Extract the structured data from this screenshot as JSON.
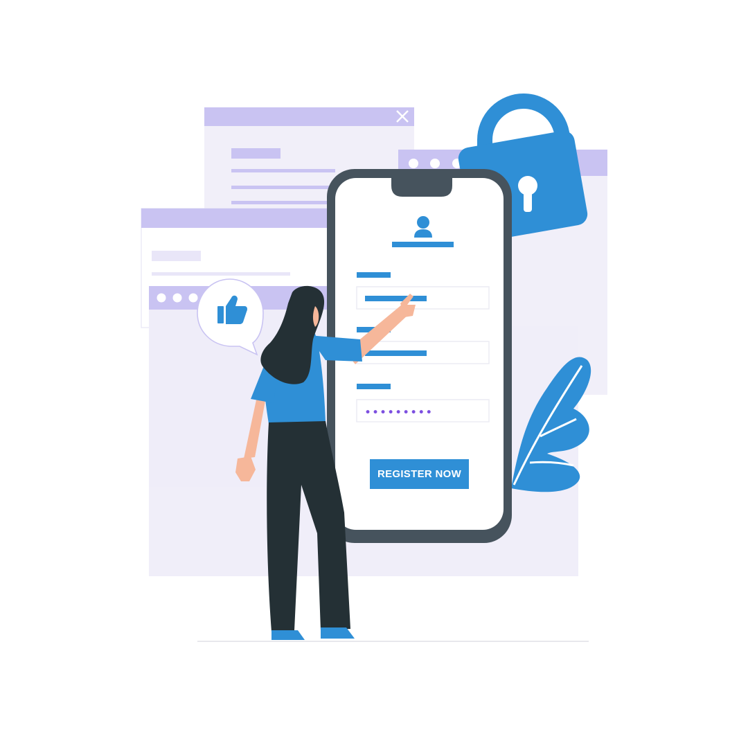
{
  "colors": {
    "window_header": "#c9c3f2",
    "window_body": "#eeecf8",
    "accent_blue": "#2f8fd6",
    "phone_frame": "#46535d",
    "password_dots": "#7c4fe0",
    "pants": "#243035",
    "skin": "#f6b79a"
  },
  "icons": [
    "close-icon",
    "lock-icon",
    "thumbs-up-icon",
    "user-icon",
    "leaf-icon"
  ],
  "form": {
    "password_mask": "•••••••••",
    "register_label": "REGISTER NOW"
  }
}
